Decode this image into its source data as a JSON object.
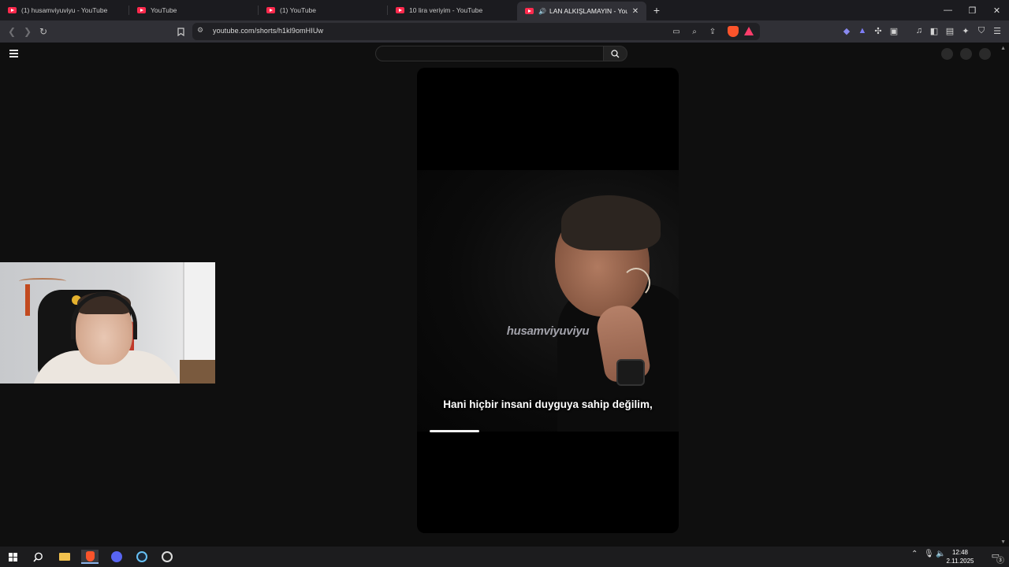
{
  "browser": {
    "tabs": [
      {
        "title": "(1) husamviyuviyu - YouTube",
        "active": false,
        "audio": false
      },
      {
        "title": "YouTube",
        "active": false,
        "audio": false
      },
      {
        "title": "(1) YouTube",
        "active": false,
        "audio": false
      },
      {
        "title": "10 lira veriyim - YouTube",
        "active": false,
        "audio": false
      },
      {
        "title": "LAN ALKIŞLAMAYIN - YouTube",
        "active": true,
        "audio": true
      }
    ],
    "new_tab_label": "+",
    "window_controls": {
      "minimize": "—",
      "restore": "❐",
      "close": "✕"
    },
    "url": "youtube.com/shorts/h1kl9omHIUw",
    "colors": {
      "accent": "#ff2a4d",
      "brave": "#fb542b"
    }
  },
  "youtube": {
    "search": {
      "placeholder": "",
      "value": ""
    },
    "short": {
      "watermark": "husamviyuviyu",
      "subtitle": "Hani hiçbir insani duyguya sahip değilim,",
      "progress_fraction": 0.19
    }
  },
  "taskbar": {
    "time": "12:48",
    "date": "2.11.2025",
    "notification_count": "3",
    "apps": [
      "windows-start",
      "search",
      "file-explorer",
      "brave",
      "discord",
      "steam",
      "obs"
    ]
  }
}
